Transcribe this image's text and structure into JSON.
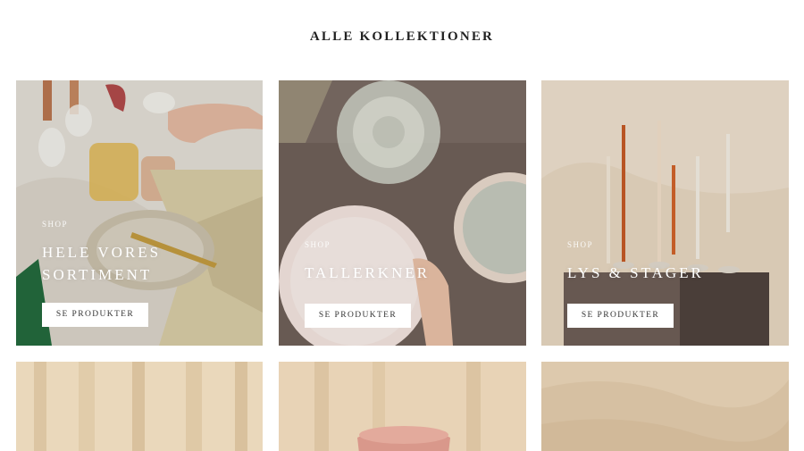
{
  "header": {
    "title": "ALLE KOLLEKTIONER"
  },
  "collections": [
    {
      "shop": "SHOP",
      "title_lines": [
        "HELE VORES",
        "SORTIMENT"
      ],
      "button": "SE PRODUKTER"
    },
    {
      "shop": "SHOP",
      "title_lines": [
        "TALLERKNER"
      ],
      "button": "SE PRODUKTER"
    },
    {
      "shop": "SHOP",
      "title_lines": [
        "LYS & STAGER"
      ],
      "button": "SE PRODUKTER"
    }
  ],
  "colors": {
    "text": "#222222",
    "button_bg": "#ffffff",
    "button_text": "#333333"
  }
}
